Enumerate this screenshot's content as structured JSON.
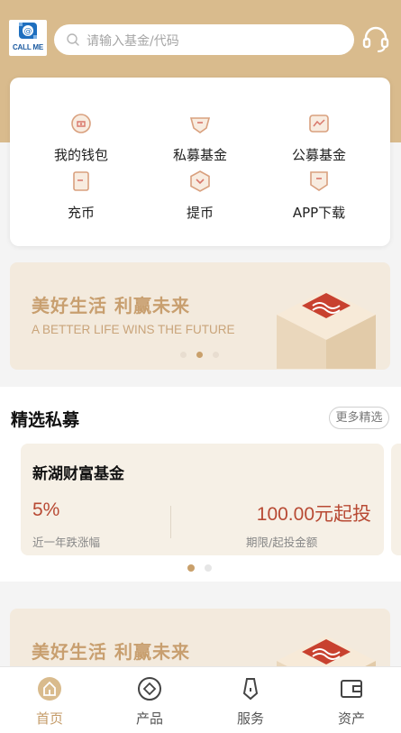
{
  "header": {
    "logo_text": "CALL ME",
    "search_placeholder": "请输入基金/代码",
    "icons": {
      "logo": "callme-logo-icon",
      "search": "search-icon",
      "support": "headset-icon"
    }
  },
  "quick_menu": [
    {
      "label": "我的钱包",
      "icon": "wallet-icon"
    },
    {
      "label": "私募基金",
      "icon": "private-fund-icon"
    },
    {
      "label": "公募基金",
      "icon": "public-fund-icon"
    },
    {
      "label": "充币",
      "icon": "deposit-icon"
    },
    {
      "label": "提币",
      "icon": "withdraw-icon"
    },
    {
      "label": "APP下载",
      "icon": "download-icon"
    }
  ],
  "banner": {
    "title": "美好生活 利赢未来",
    "subtitle": "A BETTER LIFE WINS THE FUTURE",
    "active_slide": 2,
    "slide_count": 3
  },
  "featured": {
    "title": "精选私募",
    "more_label": "更多精选",
    "fund": {
      "name": "新湖财富基金",
      "rate": "5%",
      "rate_label": "近一年跌涨幅",
      "amount": "100.00元起投",
      "amount_label": "期限/起投金额"
    },
    "active_page": 1,
    "page_count": 2
  },
  "tabs": [
    {
      "label": "首页",
      "icon": "home-icon",
      "active": true
    },
    {
      "label": "产品",
      "icon": "product-icon",
      "active": false
    },
    {
      "label": "服务",
      "icon": "service-icon",
      "active": false
    },
    {
      "label": "资产",
      "icon": "assets-icon",
      "active": false
    }
  ],
  "colors": {
    "header_bg": "#d9bb8d",
    "accent": "#c49b68",
    "price_red": "#b84a34",
    "banner_bg": "#f3eadd"
  }
}
